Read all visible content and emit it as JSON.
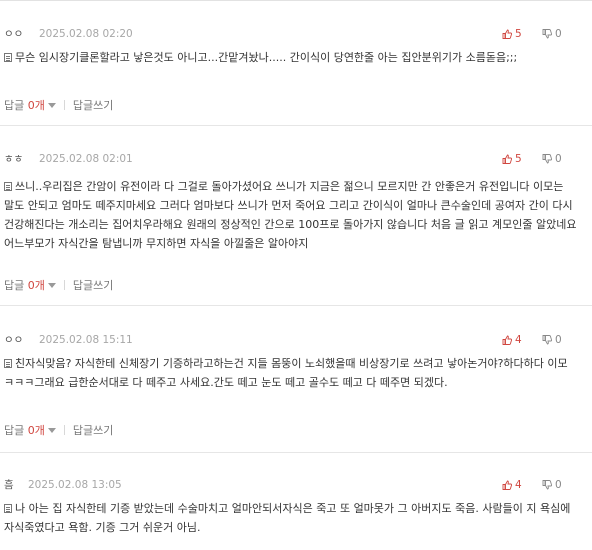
{
  "comments": [
    {
      "nick": "ㅇㅇ",
      "date": "2025.02.08 02:20",
      "up": "5",
      "down": "0",
      "text": "무슨 임시장기클론할라고 낳은것도 아니고...간맡겨놨나..... 간이식이 당연한줄 아는 집안분위기가 소름돋음;;;",
      "reply_label": "답글",
      "reply_count": "0개",
      "write_reply": "답글쓰기"
    },
    {
      "nick": "ㅎㅎ",
      "date": "2025.02.08 02:01",
      "up": "5",
      "down": "0",
      "text": "쓰니..우리집은 간암이 유전이라 다 그걸로 돌아가셨어요 쓰니가 지금은 젊으니 모르지만 간 안좋은거 유전입니다 이모는 말도 안되고 엄마도 떼주지마세요 그러다 엄마보다 쓰니가 먼저 죽어요 그리고 간이식이 얼마나 큰수술인데 공여자 간이 다시 건강해진다는 개소리는 집어치우라해요 원래의 정상적인 간으로 100프로 돌아가지 않습니다 처음 글 읽고 계모인줄 알았네요 어느부모가 자식간을 탐냅니까 무지하면 자식을 아낄줄은 알아야지",
      "reply_label": "답글",
      "reply_count": "0개",
      "write_reply": "답글쓰기"
    },
    {
      "nick": "ㅇㅇ",
      "date": "2025.02.08 15:11",
      "up": "4",
      "down": "0",
      "text": "친자식맞음? 자식한테 신체장기 기증하라고하는건 지들 몸뚱이 노쇠했을때 비상장기로 쓰려고 낳아논거야?하다하다 이모 ㅋㅋㅋ그래요 급한순서대로 다 떼주고 사세요.간도 떼고 눈도 떼고 골수도 떼고 다 떼주면 되겠다.",
      "reply_label": "답글",
      "reply_count": "0개",
      "write_reply": "답글쓰기"
    },
    {
      "nick": "흠",
      "date": "2025.02.08 13:05",
      "up": "4",
      "down": "0",
      "text": "나 아는 집 자식한테 기증 받았는데 수술마치고 얼마안되서자식은 죽고 또 얼마못가 그 아버지도 죽음. 사람들이 지 욕심에 자식죽였다고 욕함. 기증 그거 쉬운거 아님.",
      "reply_label": "",
      "reply_count": "",
      "write_reply": ""
    }
  ],
  "icons": {
    "thumb_up_color": "#d0463f",
    "thumb_down_color": "#888888"
  }
}
